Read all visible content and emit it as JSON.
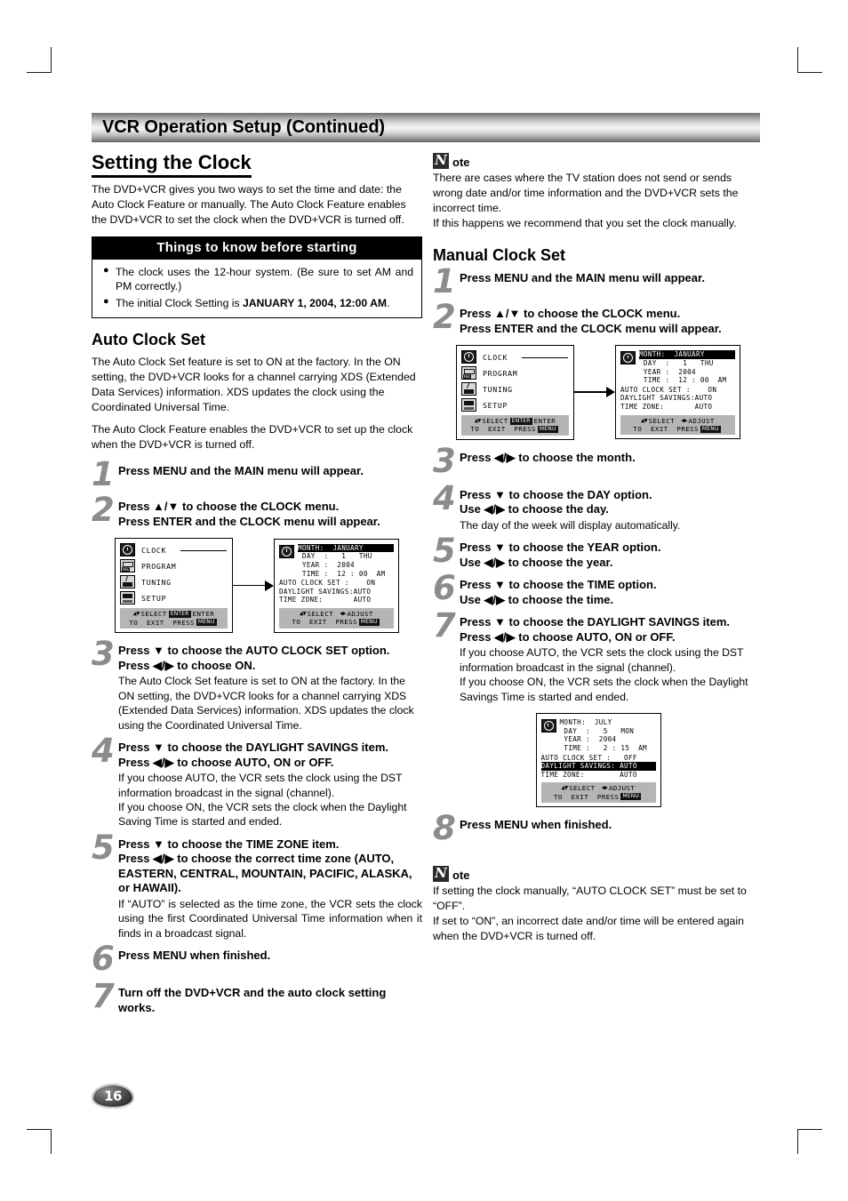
{
  "page": {
    "banner_title": "VCR Operation Setup (Continued)",
    "page_number": "16"
  },
  "left": {
    "section_title": "Setting the Clock",
    "intro": "The DVD+VCR gives you two ways to set the time and date: the Auto Clock Feature or manually. The Auto Clock Feature enables the DVD+VCR to set the clock when the DVD+VCR is turned off.",
    "know_box": {
      "title": "Things to know before starting",
      "items": [
        "The clock uses the 12-hour system. (Be sure to set AM and PM correctly.)",
        "The initial Clock Setting is JANUARY 1, 2004, 12:00 AM."
      ],
      "item2_plain": "The initial Clock Setting is ",
      "item2_bold": "JANUARY 1, 2004, 12:00 AM",
      "item2_tail": "."
    },
    "auto_title": "Auto Clock Set",
    "auto_body_1": "The Auto Clock Set feature is set to ON at the factory. In the ON setting, the DVD+VCR looks for a channel carrying XDS (Extended Data Services) information. XDS updates the clock using the Coordinated Universal Time.",
    "auto_body_2": "The Auto Clock Feature enables the DVD+VCR to set up the clock when the DVD+VCR is turned off.",
    "steps": [
      {
        "num": "1",
        "main": "Press MENU and the MAIN menu will appear.",
        "main2": "",
        "note": ""
      },
      {
        "num": "2",
        "main": "Press ▲/▼ to choose the CLOCK menu.",
        "main2": "Press ENTER and the CLOCK menu will appear.",
        "note": ""
      },
      {
        "num": "3",
        "main": "Press ▼ to choose the AUTO CLOCK SET option.",
        "main2": "Press ◀/▶ to choose ON.",
        "note": "The Auto Clock Set feature is set to ON at the factory. In the ON setting, the DVD+VCR looks for a channel carrying XDS (Extended Data Services) information. XDS updates the clock using the Coordinated Universal Time."
      },
      {
        "num": "4",
        "main": "Press ▼ to choose the DAYLIGHT SAVINGS item.",
        "main2": "Press ◀/▶ to choose AUTO, ON or OFF.",
        "note": "If you choose AUTO, the VCR sets the clock using the DST information broadcast in the signal (channel).\nIf you choose ON, the VCR sets the clock when the Daylight Saving Time is started and ended."
      },
      {
        "num": "5",
        "main": "Press ▼ to choose the TIME ZONE item.",
        "main2": "Press ◀/▶ to choose the correct time zone (AUTO, EASTERN, CENTRAL, MOUNTAIN, PACIFIC, ALASKA, or HAWAII).",
        "note": "If “AUTO” is selected as the time zone, the VCR sets the clock using the first Coordinated Universal Time information when it finds in a broadcast signal."
      },
      {
        "num": "6",
        "main": "Press MENU when finished.",
        "main2": "",
        "note": ""
      },
      {
        "num": "7",
        "main": "Turn off the DVD+VCR and the auto clock setting works.",
        "main2": "",
        "note": ""
      }
    ]
  },
  "right": {
    "note_top": {
      "n": "N",
      "ote": "ote",
      "body": "There are cases where the TV station does not send or sends wrong date and/or time information and the DVD+VCR sets the incorrect time.\nIf this happens we recommend that you set the clock manually."
    },
    "manual_title": "Manual Clock Set",
    "steps": [
      {
        "num": "1",
        "main": "Press MENU and the MAIN menu will appear.",
        "main2": "",
        "note": ""
      },
      {
        "num": "2",
        "main": "Press ▲/▼ to choose the CLOCK menu.",
        "main2": "Press ENTER and the CLOCK menu will appear.",
        "note": ""
      },
      {
        "num": "3",
        "main": "Press ◀/▶ to choose the month.",
        "main2": "",
        "note": ""
      },
      {
        "num": "4",
        "main": "Press ▼ to choose the DAY option.",
        "main2": "Use ◀/▶ to choose the day.",
        "note": "The day of the week will display automatically."
      },
      {
        "num": "5",
        "main": "Press ▼ to choose the YEAR option.",
        "main2": "Use ◀/▶ to choose the year.",
        "note": ""
      },
      {
        "num": "6",
        "main": "Press ▼ to choose the TIME option.",
        "main2": "Use ◀/▶ to choose the time.",
        "note": ""
      },
      {
        "num": "7",
        "main": "Press ▼ to choose the DAYLIGHT SAVINGS item.",
        "main2": "Press ◀/▶ to choose AUTO, ON or OFF.",
        "note": "If you choose AUTO, the VCR sets the clock using the DST information broadcast in the signal (channel).\nIf you choose ON, the VCR sets the clock when the Daylight Savings Time is started and ended."
      },
      {
        "num": "8",
        "main": "Press MENU when finished.",
        "main2": "",
        "note": ""
      }
    ],
    "note_bottom": {
      "n": "N",
      "ote": "ote",
      "body": "If setting the clock manually, “AUTO CLOCK SET” must be set to “OFF”.\nIf set to “ON”, an incorrect date and/or time will be entered again when the DVD+VCR is turned off."
    }
  },
  "osd": {
    "main_menu": {
      "items": [
        {
          "icon": "clock-icon",
          "label": "CLOCK"
        },
        {
          "icon": "rec-icon",
          "label": "PROGRAM"
        },
        {
          "icon": "tuning-icon",
          "label": "TUNING"
        },
        {
          "icon": "setup-icon",
          "label": "SETUP"
        }
      ],
      "footer_line1_a": "SELECT",
      "footer_line1_badge": "ENTER",
      "footer_line1_b": "ENTER",
      "footer_line2_a": "TO  EXIT  PRESS",
      "footer_line2_badge": "MENU"
    },
    "clock_menu_default": {
      "rows": [
        {
          "text": "MONTH:  JANUARY",
          "highlight": true
        },
        {
          "text": " DAY  :   1   THU",
          "highlight": false
        },
        {
          "text": " YEAR :  2004",
          "highlight": false
        },
        {
          "text": " TIME :  12 : 00  AM",
          "highlight": false
        },
        {
          "text": "AUTO CLOCK SET :    ON",
          "highlight": false
        },
        {
          "text": "DAYLIGHT SAVINGS:AUTO",
          "highlight": false
        },
        {
          "text": "TIME ZONE:       AUTO",
          "highlight": false
        }
      ],
      "footer_line1_a": "SELECT",
      "footer_line1_b": "ADJUST",
      "footer_line2_a": "TO  EXIT  PRESS",
      "footer_line2_badge": "MENU"
    },
    "clock_menu_example": {
      "rows": [
        {
          "text": "MONTH:  JULY",
          "highlight": false
        },
        {
          "text": " DAY  :   5   MON",
          "highlight": false
        },
        {
          "text": " YEAR :  2004",
          "highlight": false
        },
        {
          "text": " TIME :   2 : 15  AM",
          "highlight": false
        },
        {
          "text": "AUTO CLOCK SET :   OFF",
          "highlight": false
        },
        {
          "text": "DAYLIGHT SAVINGS: AUTO",
          "highlight": true
        },
        {
          "text": "TIME ZONE:        AUTO",
          "highlight": false
        }
      ],
      "footer_line1_a": "SELECT",
      "footer_line1_b": "ADJUST",
      "footer_line2_a": "TO  EXIT  PRESS",
      "footer_line2_badge": "MENU"
    }
  }
}
